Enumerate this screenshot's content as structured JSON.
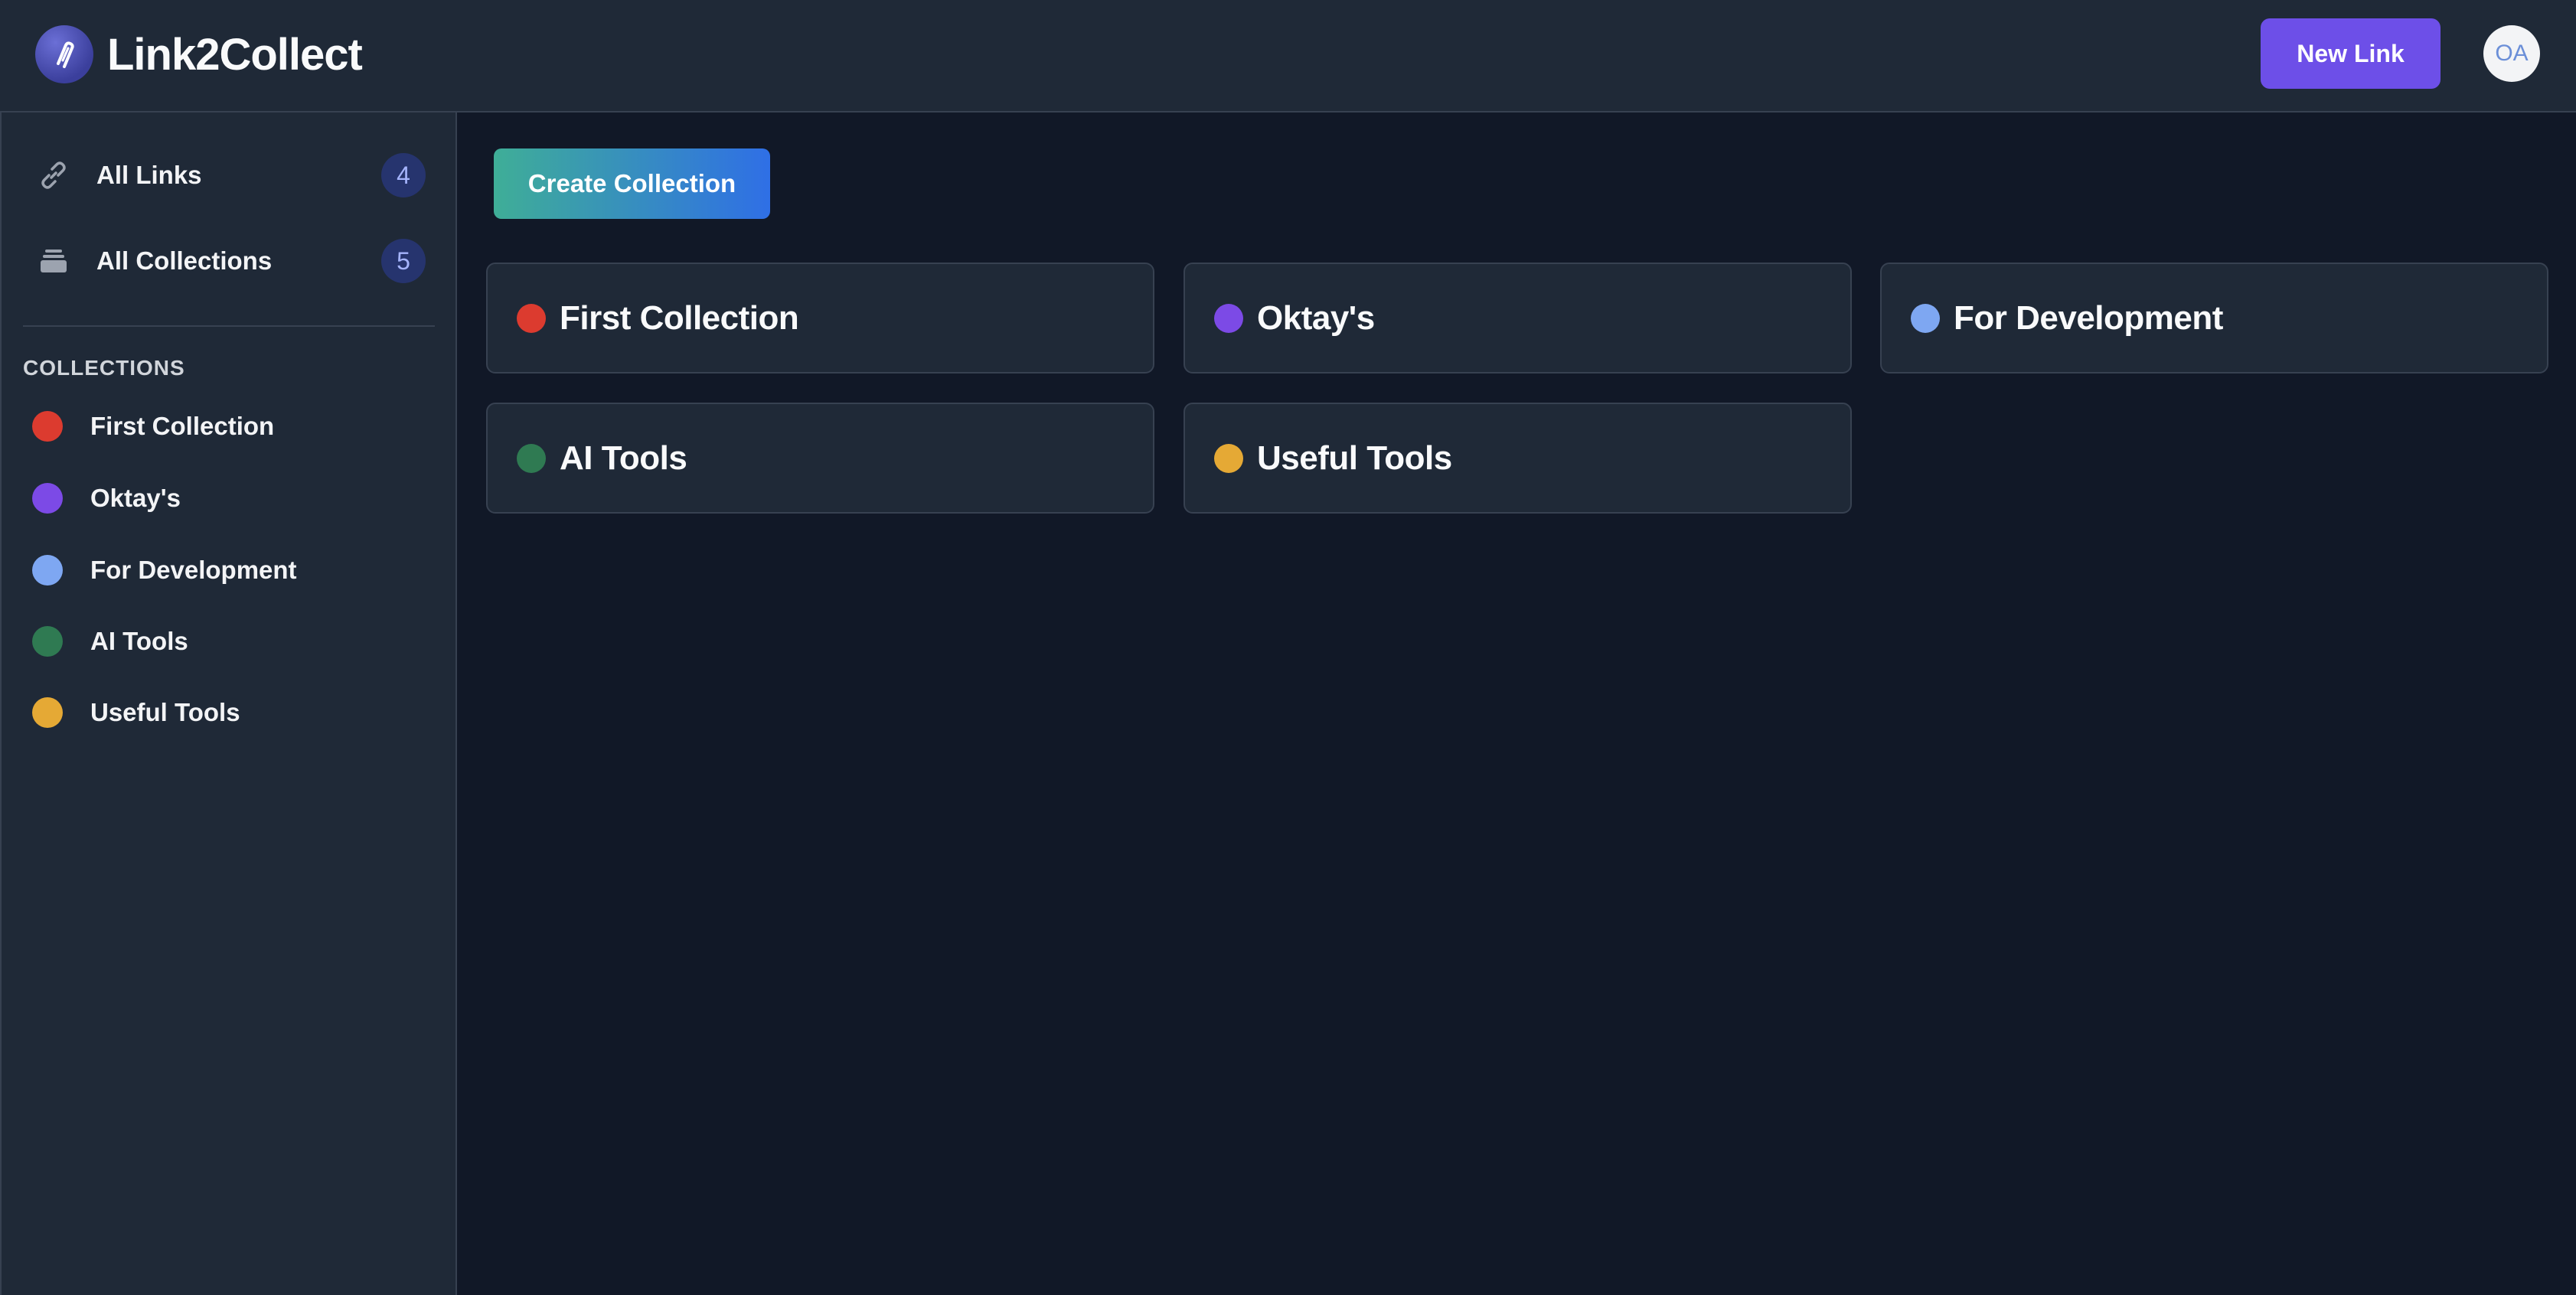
{
  "header": {
    "app_title": "Link2Collect",
    "new_link_label": "New Link",
    "avatar_initials": "OA"
  },
  "sidebar": {
    "nav": [
      {
        "label": "All Links",
        "count": "4",
        "icon": "link-icon"
      },
      {
        "label": "All Collections",
        "count": "5",
        "icon": "stack-icon"
      }
    ],
    "section_label": "COLLECTIONS",
    "collections": [
      {
        "label": "First Collection",
        "color": "#dc3b2f"
      },
      {
        "label": "Oktay's",
        "color": "#7c4ae6"
      },
      {
        "label": "For Development",
        "color": "#7ea7f2"
      },
      {
        "label": "AI Tools",
        "color": "#2f7a52"
      },
      {
        "label": "Useful Tools",
        "color": "#e5a935"
      }
    ]
  },
  "main": {
    "create_collection_label": "Create Collection",
    "cards": [
      {
        "title": "First Collection",
        "color": "#dc3b2f"
      },
      {
        "title": "Oktay's",
        "color": "#7c4ae6"
      },
      {
        "title": "For Development",
        "color": "#7ea7f2"
      },
      {
        "title": "AI Tools",
        "color": "#2f7a52"
      },
      {
        "title": "Useful Tools",
        "color": "#e5a935"
      }
    ]
  },
  "colors": {
    "background": "#111827",
    "panel": "#1f2937",
    "accent_purple": "#6d4fe8",
    "badge_bg": "#26346e"
  }
}
